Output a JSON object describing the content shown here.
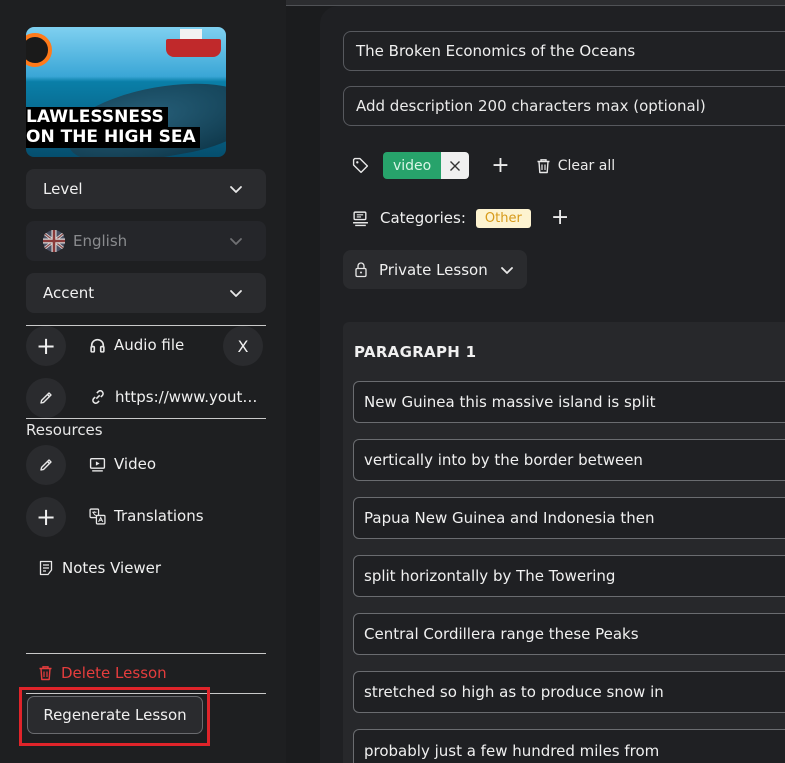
{
  "sidebar": {
    "thumbnail": {
      "caption_line1": "LAWLESSNESS",
      "caption_line2": "ON THE HIGH SEA"
    },
    "level_label": "Level",
    "language_label": "English",
    "accent_label": "Accent",
    "audio": {
      "add_symbol": "+",
      "label": "Audio file",
      "remove_label": "X"
    },
    "link": {
      "url": "https://www.yout…"
    },
    "resources_title": "Resources",
    "resources": {
      "video_label": "Video",
      "translations_label": "Translations",
      "notes_label": "Notes Viewer"
    },
    "delete_label": "Delete Lesson",
    "regenerate_label": "Regenerate Lesson"
  },
  "main": {
    "title_value": "The Broken Economics of the Oceans",
    "description_placeholder": "Add description 200 characters max (optional)",
    "tags": {
      "items": [
        "video"
      ],
      "clear_label": "Clear all"
    },
    "categories": {
      "label": "Categories:",
      "items": [
        "Other"
      ]
    },
    "visibility_label": "Private Lesson",
    "paragraph": {
      "title": "PARAGRAPH 1",
      "sentences": [
        "New Guinea this massive island is split",
        "vertically into by the border between",
        "Papua New Guinea and Indonesia then",
        "split horizontally by The Towering",
        "Central Cordillera range these Peaks",
        "stretched so high as to produce snow in",
        "probably just a few hundred miles from"
      ]
    }
  },
  "colors": {
    "danger": "#e53d3d",
    "tag_green": "#27a36b",
    "category_bg": "#fdf3d0",
    "category_text": "#d79a1a",
    "highlight_box": "#e0242a"
  }
}
